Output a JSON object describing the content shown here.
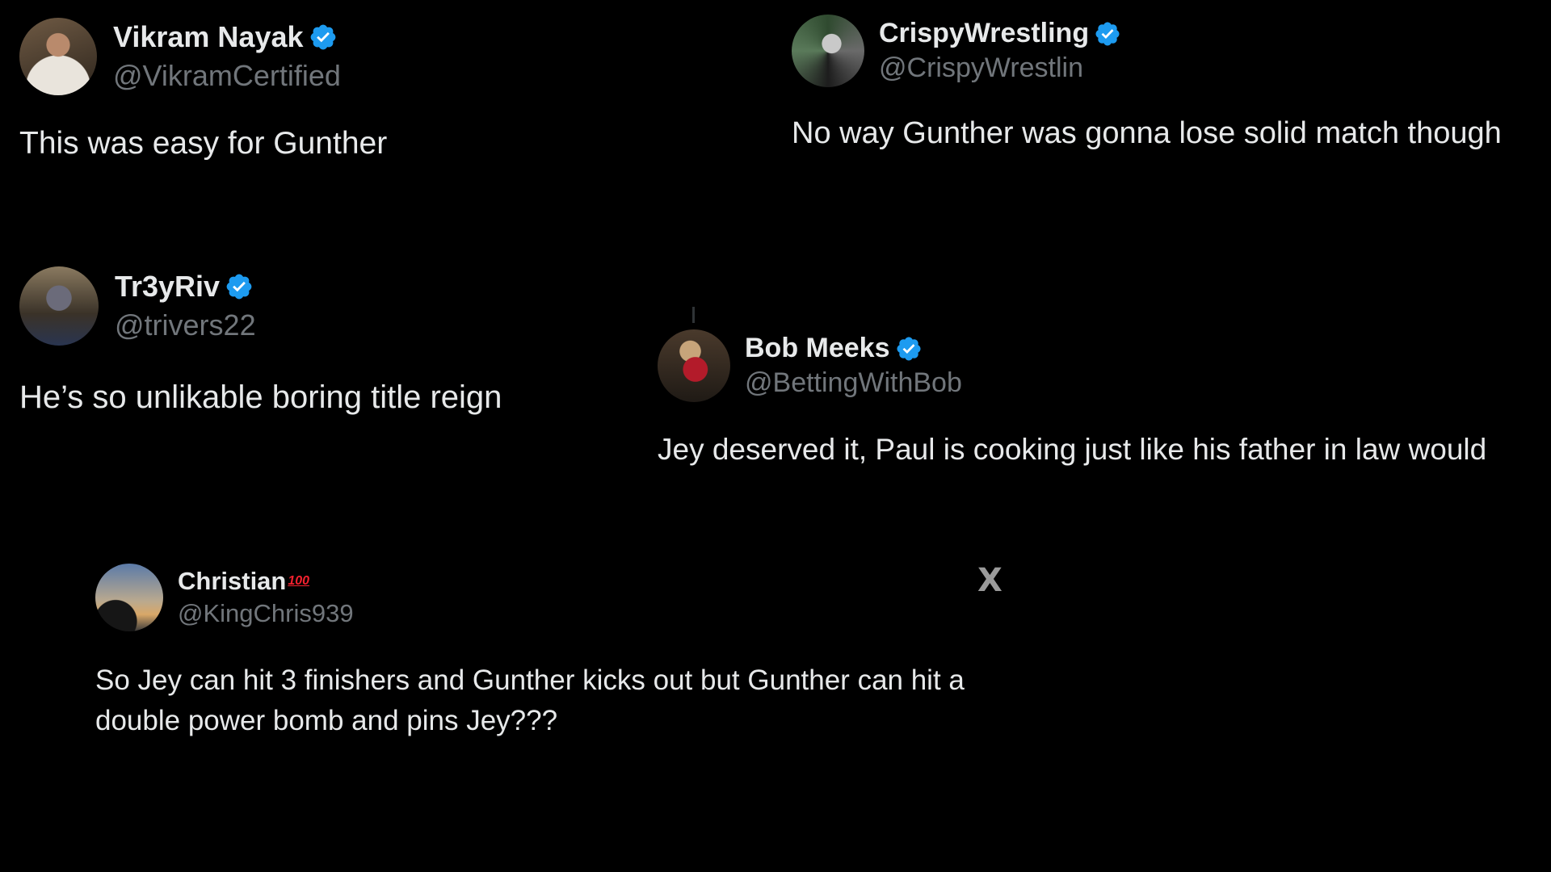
{
  "colors": {
    "background": "#000000",
    "text": "#e7e9ea",
    "handle": "#71767b",
    "verified": "#1d9bf0",
    "emoji_100": "#f4212e"
  },
  "tweets": [
    {
      "display_name": "Vikram Nayak",
      "handle": "@VikramCertified",
      "verified": true,
      "text": "This was easy for Gunther"
    },
    {
      "display_name": "CrispyWrestling",
      "handle": "@CrispyWrestlin",
      "verified": true,
      "text": "No way Gunther was gonna lose solid match though"
    },
    {
      "display_name": "Tr3yRiv",
      "handle": "@trivers22",
      "verified": true,
      "text": "He’s so unlikable boring title reign"
    },
    {
      "display_name": "Bob Meeks",
      "handle": "@BettingWithBob",
      "verified": true,
      "text": "Jey deserved it, Paul is cooking just like his father in law would"
    },
    {
      "display_name": "Christian",
      "name_emoji": "100",
      "handle": "@KingChris939",
      "verified": false,
      "text": "So Jey can hit 3 finishers and Gunther kicks out but Gunther can hit a double power bomb and pins Jey???"
    }
  ],
  "icons": {
    "verified": "verified-badge-icon",
    "x_logo": "x-logo-icon"
  },
  "x_logo_glyph": "X"
}
